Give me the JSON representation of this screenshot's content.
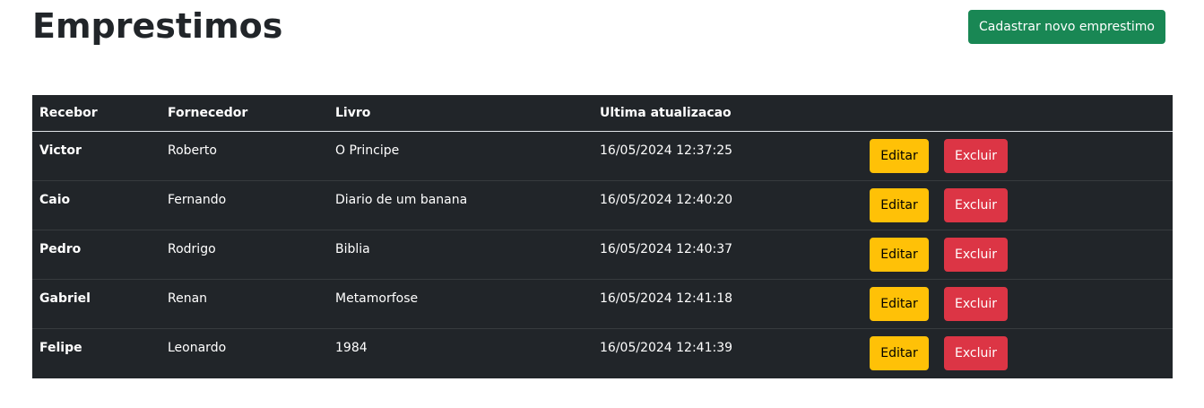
{
  "header": {
    "title": "Emprestimos",
    "new_button_label": "Cadastrar novo emprestimo"
  },
  "table": {
    "columns": [
      "Recebor",
      "Fornecedor",
      "Livro",
      "Ultima atualizacao"
    ],
    "rows": [
      {
        "recebor": "Victor",
        "fornecedor": "Roberto",
        "livro": "O Principe",
        "atualizacao": "16/05/2024 12:37:25"
      },
      {
        "recebor": "Caio",
        "fornecedor": "Fernando",
        "livro": "Diario de um banana",
        "atualizacao": "16/05/2024 12:40:20"
      },
      {
        "recebor": "Pedro",
        "fornecedor": "Rodrigo",
        "livro": "Biblia",
        "atualizacao": "16/05/2024 12:40:37"
      },
      {
        "recebor": "Gabriel",
        "fornecedor": "Renan",
        "livro": "Metamorfose",
        "atualizacao": "16/05/2024 12:41:18"
      },
      {
        "recebor": "Felipe",
        "fornecedor": "Leonardo",
        "livro": "1984",
        "atualizacao": "16/05/2024 12:41:39"
      }
    ],
    "edit_label": "Editar",
    "delete_label": "Excluir"
  },
  "colors": {
    "table_bg": "#212529",
    "success": "#198754",
    "warning": "#ffc107",
    "danger": "#dc3545"
  }
}
